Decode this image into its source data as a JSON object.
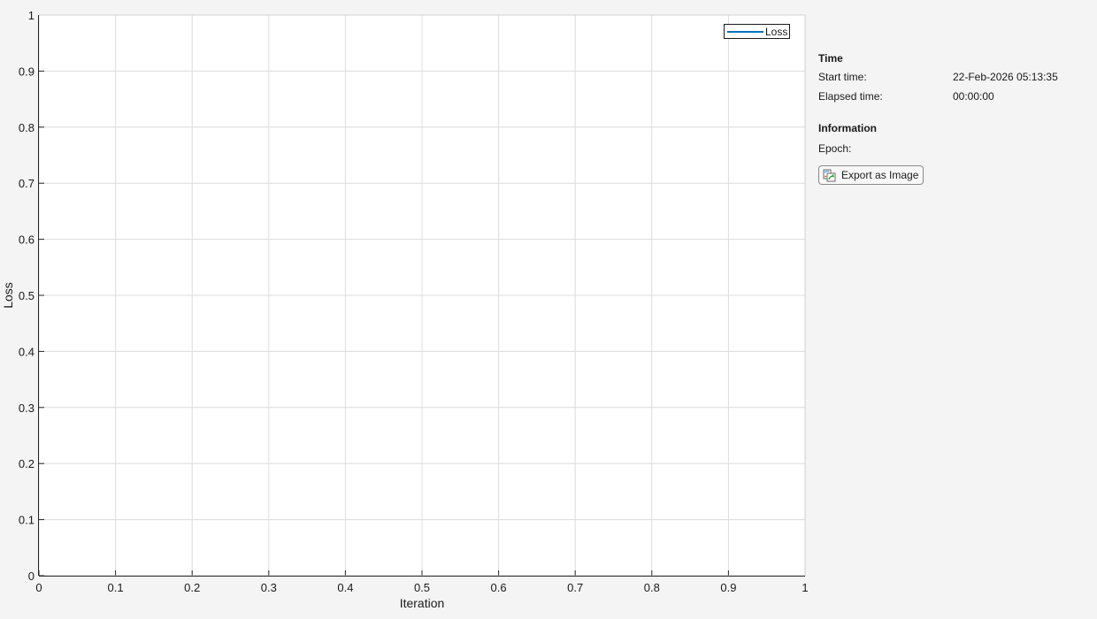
{
  "chart_data": {
    "type": "line",
    "xlabel": "Iteration",
    "ylabel": "Loss",
    "xlim": [
      0,
      1
    ],
    "ylim": [
      0,
      1
    ],
    "xticks": [
      "0",
      "0.1",
      "0.2",
      "0.3",
      "0.4",
      "0.5",
      "0.6",
      "0.7",
      "0.8",
      "0.9",
      "1"
    ],
    "yticks": [
      "0",
      "0.1",
      "0.2",
      "0.3",
      "0.4",
      "0.5",
      "0.6",
      "0.7",
      "0.8",
      "0.9",
      "1"
    ],
    "grid": true,
    "legend_position": "top-right",
    "series": [
      {
        "name": "Loss",
        "color": "#0072bd",
        "x": [],
        "y": []
      }
    ]
  },
  "info_panel": {
    "time_heading": "Time",
    "start_time_label": "Start time:",
    "start_time_value": "22-Feb-2026 05:13:35",
    "elapsed_time_label": "Elapsed time:",
    "elapsed_time_value": "00:00:00",
    "information_heading": "Information",
    "epoch_label": "Epoch:",
    "export_button": "Export as Image",
    "export_icon": "export-image-icon"
  }
}
